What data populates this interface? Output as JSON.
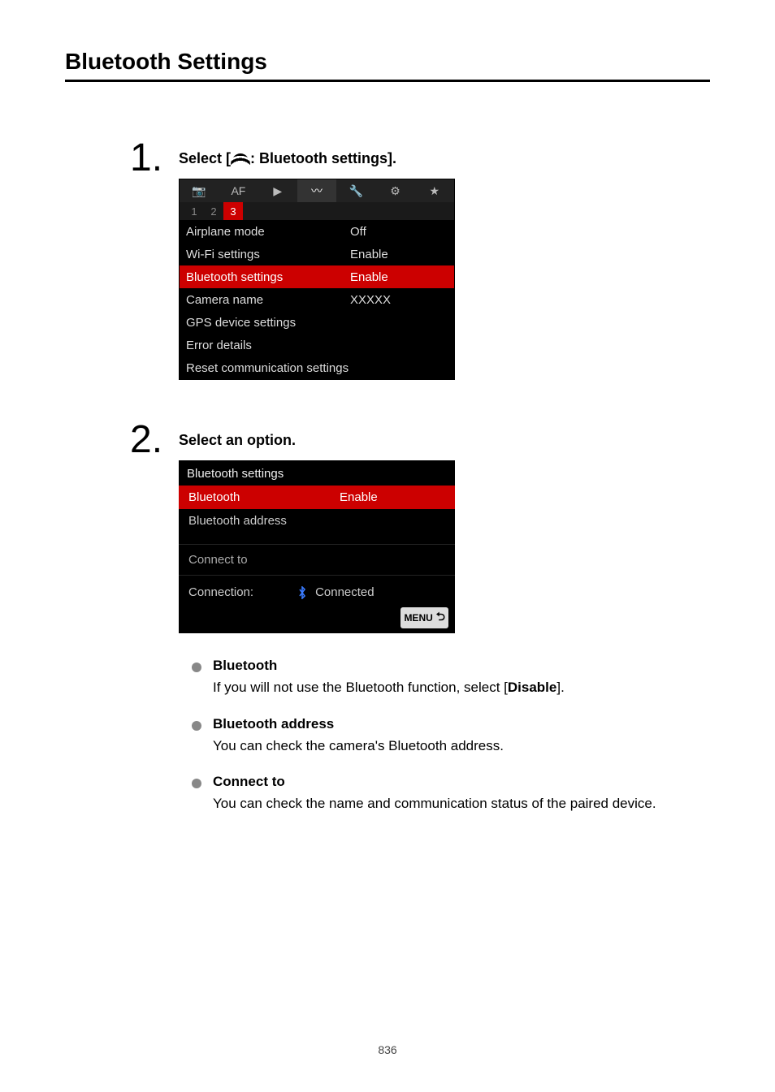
{
  "title": "Bluetooth Settings",
  "step1": {
    "num": "1.",
    "title_pre": "Select [",
    "title_post": ": Bluetooth settings].",
    "tabs": [
      "📷",
      "AF",
      "▶",
      "〰",
      "🔧",
      "⚙",
      "★"
    ],
    "active_tab_index": 3,
    "subtabs": [
      "1",
      "2",
      "3"
    ],
    "active_subtab_index": 2,
    "rows": [
      {
        "label": "Airplane mode",
        "val": "Off",
        "selected": false
      },
      {
        "label": "Wi-Fi settings",
        "val": "Enable",
        "selected": false
      },
      {
        "label": "Bluetooth settings",
        "val": "Enable",
        "selected": true
      },
      {
        "label": "Camera name",
        "val": "XXXXX",
        "selected": false
      },
      {
        "label": "GPS device settings",
        "val": "",
        "selected": false
      },
      {
        "label": "Error details",
        "val": "",
        "selected": false
      },
      {
        "label": "Reset communication settings",
        "val": "",
        "selected": false
      }
    ]
  },
  "step2": {
    "num": "2.",
    "title": "Select an option.",
    "header": "Bluetooth settings",
    "rows": [
      {
        "label": "Bluetooth",
        "val": "Enable",
        "selected": true
      },
      {
        "label": "Bluetooth address",
        "val": "",
        "selected": false
      }
    ],
    "connect_label": "Connect to",
    "status_label": "Connection:",
    "status_value": "Connected",
    "menu_badge": "MENU"
  },
  "bullets": [
    {
      "title": "Bluetooth",
      "text_pre": "If you will not use the Bluetooth function, select [",
      "text_bold": "Disable",
      "text_post": "]."
    },
    {
      "title": "Bluetooth address",
      "text": "You can check the camera's Bluetooth address."
    },
    {
      "title": "Connect to",
      "text": "You can check the name and communication status of the paired device."
    }
  ],
  "page_num": "836"
}
